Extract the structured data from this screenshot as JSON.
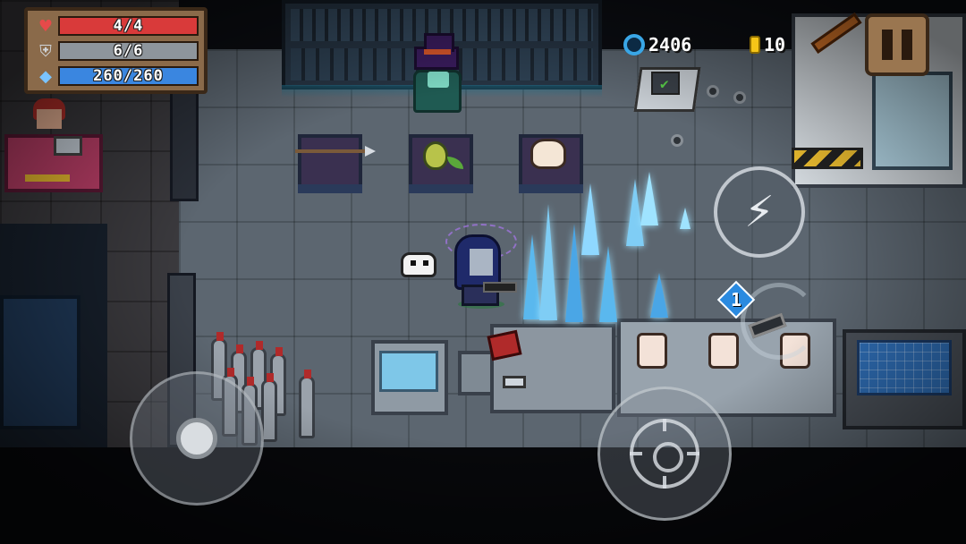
{
  "hud": {
    "health": {
      "label": "4/4",
      "current": 4,
      "max": 4,
      "color": "#d93a3a",
      "icon": "heart-icon"
    },
    "armor": {
      "label": "6/6",
      "current": 6,
      "max": 6,
      "color": "#8e959c",
      "icon": "shield-icon"
    },
    "energy": {
      "label": "260/260",
      "current": 260,
      "max": 260,
      "color": "#3a86e0",
      "icon": "diamond-icon"
    }
  },
  "currency": {
    "gems": {
      "value": "2406",
      "icon": "gem-icon"
    },
    "coins": {
      "value": "10",
      "icon": "coin-icon"
    }
  },
  "controls": {
    "pause_icon": "pause-icon",
    "skill_icon": "lightning-icon",
    "skill_glyph": "⚡",
    "weapon_slot_number": "1",
    "attack_icon": "crosshair-icon",
    "joystick_icon": "joystick-knob"
  },
  "colors": {
    "floor": "#5c6670",
    "hud_frame": "#8a6a4a",
    "ice": "#9fe3ff"
  }
}
